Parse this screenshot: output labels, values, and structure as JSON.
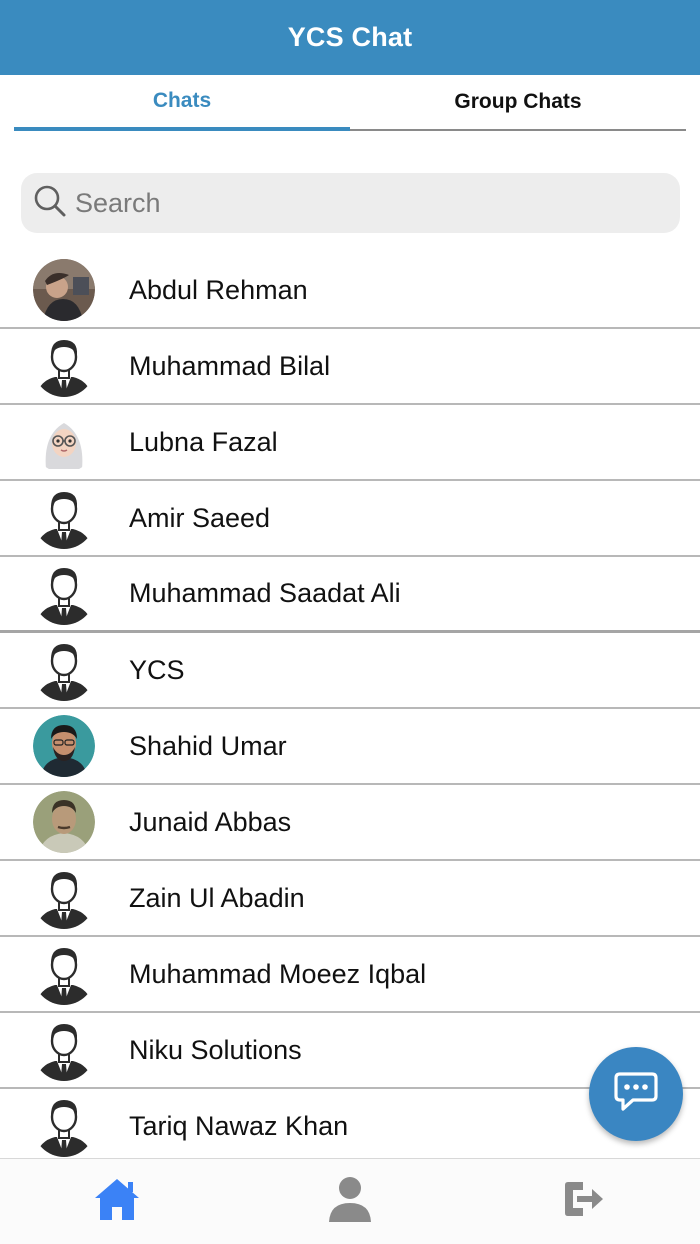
{
  "header": {
    "title": "YCS Chat",
    "color": "#3a8bbf"
  },
  "tabs": [
    {
      "label": "Chats",
      "active": true
    },
    {
      "label": "Group Chats",
      "active": false
    }
  ],
  "search": {
    "placeholder": "Search",
    "value": "",
    "icon": "search-icon"
  },
  "contacts": [
    {
      "name": "Abdul Rehman",
      "avatar": "photo-dark"
    },
    {
      "name": "Muhammad Bilal",
      "avatar": "default-user-icon"
    },
    {
      "name": "Lubna Fazal",
      "avatar": "hijab-glasses-avatar"
    },
    {
      "name": "Amir Saeed",
      "avatar": "default-user-icon"
    },
    {
      "name": "Muhammad Saadat Ali",
      "avatar": "default-user-icon"
    },
    {
      "name": "YCS",
      "avatar": "default-user-icon"
    },
    {
      "name": "Shahid Umar",
      "avatar": "photo-teal"
    },
    {
      "name": "Junaid Abbas",
      "avatar": "photo-olive"
    },
    {
      "name": "Zain Ul Abadin",
      "avatar": "default-user-icon"
    },
    {
      "name": "Muhammad Moeez Iqbal",
      "avatar": "default-user-icon"
    },
    {
      "name": "Niku Solutions",
      "avatar": "default-user-icon"
    },
    {
      "name": "Tariq Nawaz Khan",
      "avatar": "default-user-icon"
    }
  ],
  "fab": {
    "icon": "chat-bubble-icon",
    "color": "#3a86c2"
  },
  "bottom_nav": [
    {
      "icon": "home-icon",
      "active": true,
      "color": "#3b82f6"
    },
    {
      "icon": "person-icon",
      "active": false,
      "color": "#8a8a8a"
    },
    {
      "icon": "logout-icon",
      "active": false,
      "color": "#8a8a8a"
    }
  ]
}
